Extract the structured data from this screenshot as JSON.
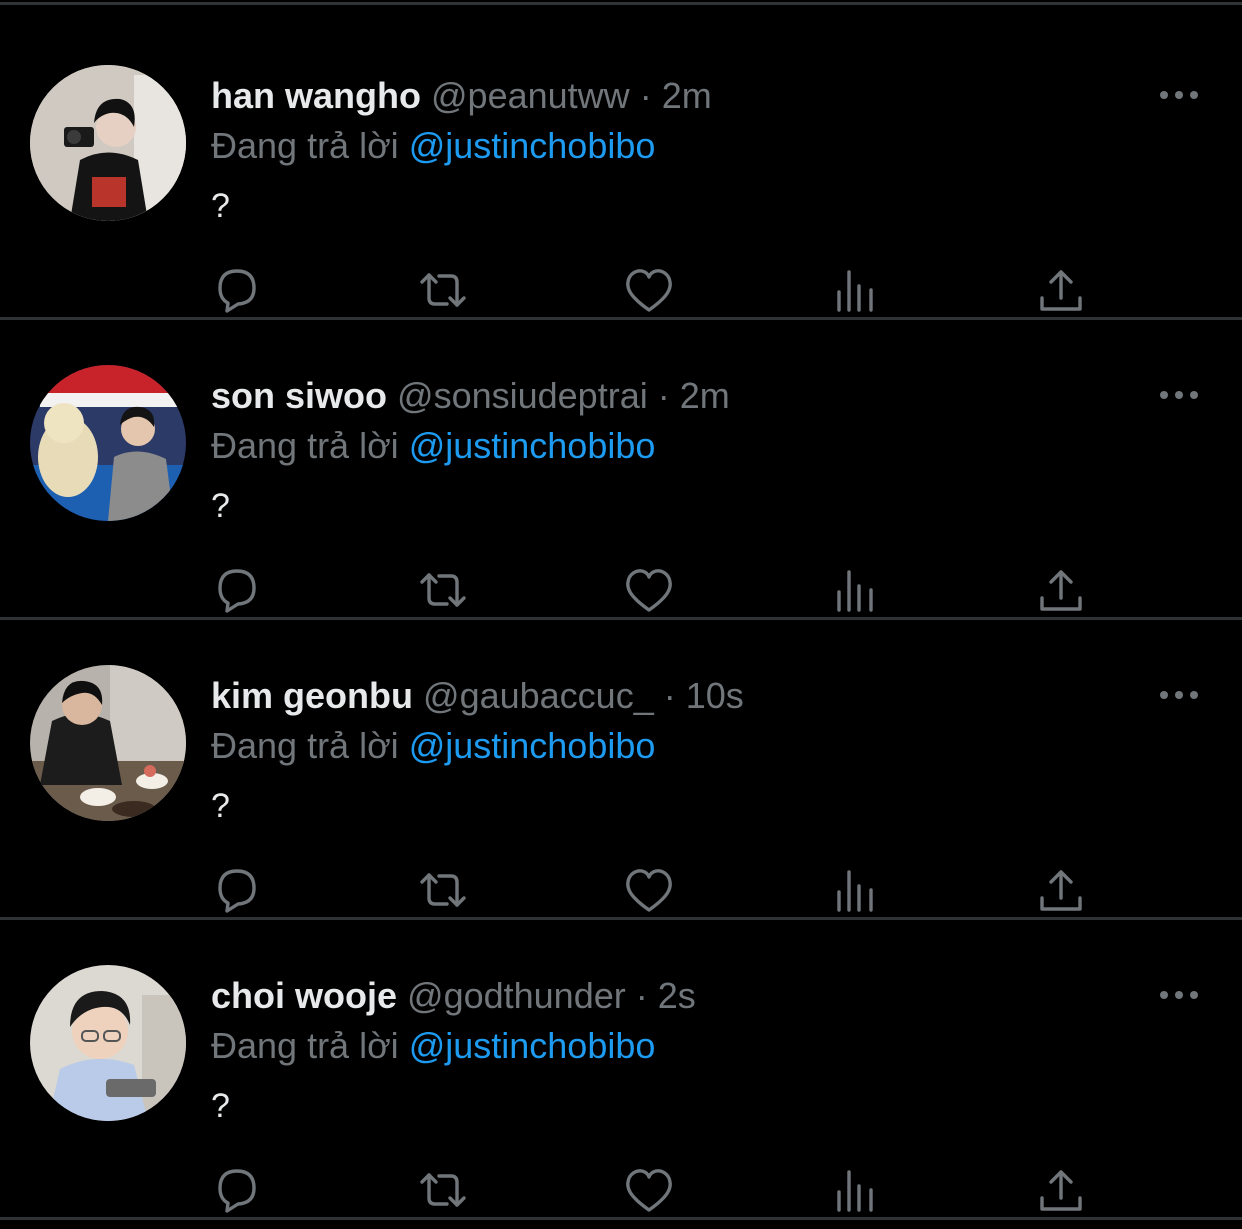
{
  "colors": {
    "background": "#000000",
    "divider": "#2f3336",
    "primary_text": "#e7e9ea",
    "secondary_text": "#71767b",
    "mention": "#1d9bf0"
  },
  "icons": {
    "more": "more-horizontal-icon",
    "reply": "reply-bubble-icon",
    "retweet": "retweet-icon",
    "like": "heart-icon",
    "views": "views-bar-chart-icon",
    "share": "share-upload-icon"
  },
  "tweets": [
    {
      "display_name": "han wangho",
      "handle": "@peanutww",
      "separator": "·",
      "time": "2m",
      "reply_prefix": "Đang trả lời",
      "reply_to": "@justinchobibo",
      "text": "?"
    },
    {
      "display_name": "son siwoo",
      "handle": "@sonsiudeptrai",
      "separator": "·",
      "time": "2m",
      "reply_prefix": "Đang trả lời",
      "reply_to": "@justinchobibo",
      "text": "?"
    },
    {
      "display_name": "kim geonbu",
      "handle": "@gaubaccuc_",
      "separator": "·",
      "time": "10s",
      "reply_prefix": "Đang trả lời",
      "reply_to": "@justinchobibo",
      "text": "?"
    },
    {
      "display_name": "choi wooje",
      "handle": "@godthunder",
      "separator": "·",
      "time": "2s",
      "reply_prefix": "Đang trả lời",
      "reply_to": "@justinchobibo",
      "text": "?"
    }
  ]
}
